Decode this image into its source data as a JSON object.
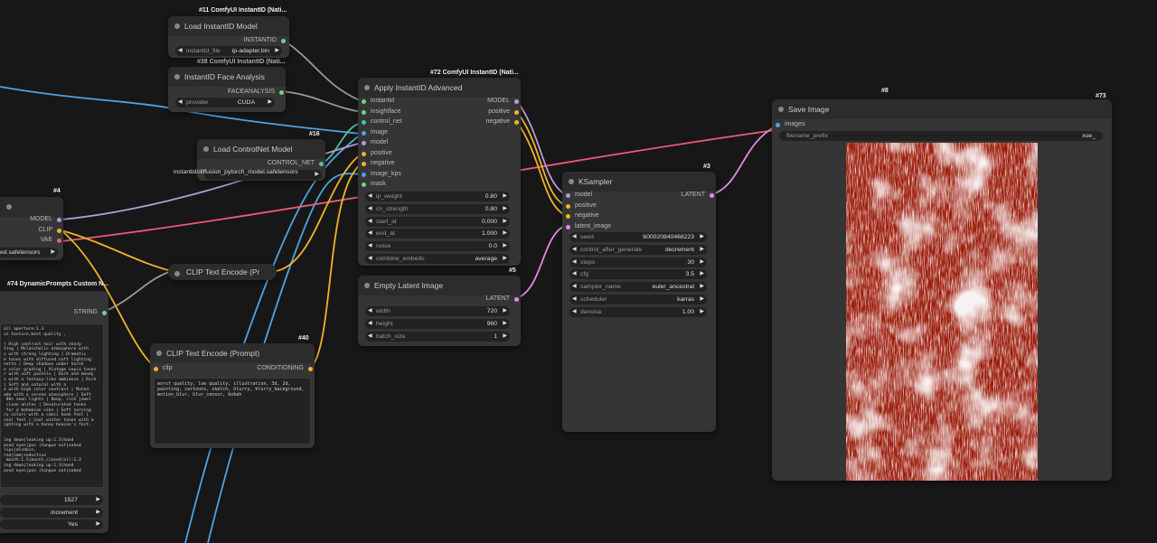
{
  "nodes": {
    "load_instantid": {
      "badge": "#11 ComfyUI InstantID (Nati...",
      "title": "Load InstantID Model",
      "output": "INSTANTID",
      "widget_label": "instantid_file",
      "widget_value": "ip-adapter.bin"
    },
    "face_analysis": {
      "badge": "#38 ComfyUI InstantID (Nati...",
      "title": "InstantID Face Analysis",
      "output": "FACEANALYSIS",
      "widget_label": "provider",
      "widget_value": "CUDA"
    },
    "controlnet": {
      "badge": "#16",
      "title": "Load ControlNet Model",
      "output": "CONTROL_NET",
      "widget_label": "instantid/diffusion_pytorch_model.safetensors"
    },
    "apply_instantid": {
      "badge": "#72 ComfyUI InstantID (Nati...",
      "title": "Apply InstantID Advanced",
      "inputs": [
        "instantid",
        "insightface",
        "control_net",
        "image",
        "model",
        "positive",
        "negative",
        "image_kps",
        "mask"
      ],
      "outputs": [
        "MODEL",
        "positive",
        "negative"
      ],
      "widgets": [
        {
          "label": "ip_weight",
          "value": "0.80"
        },
        {
          "label": "cn_strength",
          "value": "0.80"
        },
        {
          "label": "start_at",
          "value": "0.000"
        },
        {
          "label": "end_at",
          "value": "1.000"
        },
        {
          "label": "noise",
          "value": "0.0"
        },
        {
          "label": "combine_embeds",
          "value": "average"
        }
      ]
    },
    "checkpoint": {
      "badge": "#4",
      "outputs": [
        "MODEL",
        "CLIP",
        "VAE"
      ],
      "widget_value": "ed.safetensors"
    },
    "dynamic_prompts": {
      "badge": "#74 DynamicPrompts Custom N...",
      "output": "STRING",
      "text": "all aperture:1.3\nin texture,best quality ,\n\n) High contrast noir with sharp\nting | Melancholic atmosphere with\ns with strong lighting | Dramatic\ne tones with diffused soft lighting\nnetta | Deep shadows under harsh\ne color grading | Vintage sepia tones\nr with soft pastels | Dark and moody\ns with a fantasy-like ambiance | Rich\n| Soft and natural with a\ne with high color contrast | Muted\nade with a serene atmosphere | Soft\n 80s neon lights | Deep, rich jewel\n clean whites | Desaturated tones\n for a bohemian vibe | Soft serving\nry colors with a comic book feel |\nseal feel | Cool winter tones with a\nighting with a honey beacon's_fest,\n\n\ning down|looking up:1.3|hand\nosed eyes|pov |tongue out|naked\nlips|disdain,\nred|hmm|seductive\n mouth:1.5|mouth_closed|all:1.3\ning down|looking up:1.3|hand\nosed eyes|pov |tongue out|naked",
      "seed": "1527",
      "control": "increment",
      "enabled": "Yes"
    },
    "clip_encode_1": {
      "title": "CLIP Text Encode (Pr"
    },
    "clip_encode_2": {
      "badge": "#40",
      "title": "CLIP Text Encode (Prompt)",
      "input": "clip",
      "output": "CONDITIONING",
      "text": "worst quality, low quality, illustration, 3d, 2d, painting, cartoons, sketch, blurry, blurry_background, motion_blur, blur_censor, bokeh"
    },
    "empty_latent": {
      "badge": "#5",
      "title": "Empty Latent Image",
      "output": "LATENT",
      "widgets": [
        {
          "label": "width",
          "value": "720"
        },
        {
          "label": "height",
          "value": "960"
        },
        {
          "label": "batch_size",
          "value": "1"
        }
      ]
    },
    "ksampler": {
      "badge": "#3",
      "title": "KSampler",
      "inputs": [
        "model",
        "positive",
        "negative",
        "latent_image"
      ],
      "output": "LATENT",
      "widgets": [
        {
          "label": "seed",
          "value": "600020840468223"
        },
        {
          "label": "control_after_generate",
          "value": "decrement"
        },
        {
          "label": "steps",
          "value": "30"
        },
        {
          "label": "cfg",
          "value": "3.5"
        },
        {
          "label": "sampler_name",
          "value": "euler_ancestral"
        },
        {
          "label": "scheduler",
          "value": "karras"
        },
        {
          "label": "denoise",
          "value": "1.00"
        }
      ]
    },
    "save_image": {
      "badge_a": "#8",
      "badge_b": "#73",
      "title": "Save Image",
      "input": "images",
      "widget_label": "filename_prefix",
      "widget_value": "xue_"
    }
  },
  "colors": {
    "canvas": "#171717",
    "node": "#353535",
    "image": "#9b1c0a",
    "wire_blue": "#4da3e6",
    "wire_yellow": "#f0b428",
    "wire_pink": "#f05a78",
    "wire_purple": "#b79ad8",
    "wire_gray": "#9a9a9a",
    "wire_magenta": "#e888e8"
  }
}
